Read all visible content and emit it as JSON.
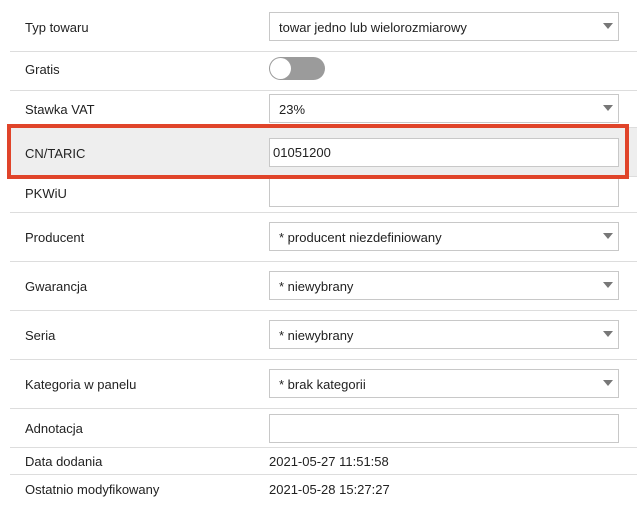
{
  "fields": {
    "product_type": {
      "label": "Typ towaru",
      "value": "towar jedno lub wielorozmiarowy"
    },
    "gratis": {
      "label": "Gratis",
      "enabled": false
    },
    "vat_rate": {
      "label": "Stawka VAT",
      "value": "23%"
    },
    "cn_taric": {
      "label": "CN/TARIC",
      "value": "01051200"
    },
    "pkwiu": {
      "label": "PKWiU",
      "value": ""
    },
    "producer": {
      "label": "Producent",
      "value": "* producent niezdefiniowany"
    },
    "warranty": {
      "label": "Gwarancja",
      "value": "* niewybrany"
    },
    "series": {
      "label": "Seria",
      "value": "* niewybrany"
    },
    "panel_category": {
      "label": "Kategoria w panelu",
      "value": "* brak kategorii"
    },
    "annotation": {
      "label": "Adnotacja",
      "value": ""
    },
    "date_added": {
      "label": "Data dodania",
      "value": "2021-05-27 11:51:58"
    },
    "last_modified": {
      "label": "Ostatnio modyfikowany",
      "value": "2021-05-28 15:27:27"
    }
  },
  "colors": {
    "highlight_border": "#e0442a",
    "highlight_row_bg": "#eeeeee",
    "toggle_off": "#9b9b9b"
  },
  "icons": {
    "select_caret": "chevron-down-icon"
  }
}
